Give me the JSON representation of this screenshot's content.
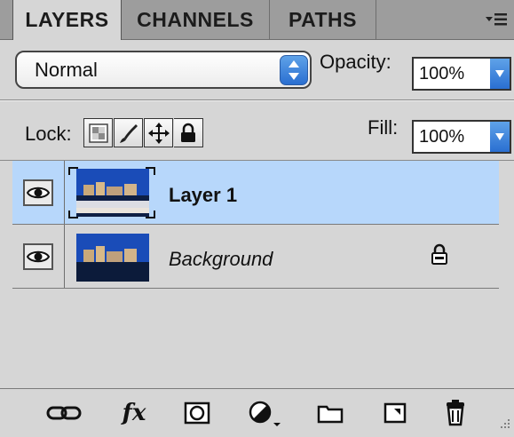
{
  "tabs": [
    {
      "label": "LAYERS",
      "active": true
    },
    {
      "label": "CHANNELS",
      "active": false
    },
    {
      "label": "PATHS",
      "active": false
    }
  ],
  "panel_menu_icon": "panel-menu-icon",
  "blend_mode": {
    "value": "Normal"
  },
  "opacity": {
    "label": "Opacity:",
    "value": "100%"
  },
  "lock": {
    "label": "Lock:",
    "icons": [
      "lock-transparent-pixels-icon",
      "lock-image-pixels-icon",
      "lock-position-icon",
      "lock-all-icon"
    ]
  },
  "fill": {
    "label": "Fill:",
    "value": "100%"
  },
  "layers": [
    {
      "name": "Layer 1",
      "visible": true,
      "selected": true,
      "locked": false
    },
    {
      "name": "Background",
      "visible": true,
      "selected": false,
      "locked": true
    }
  ],
  "toolbar": [
    "link-layers-icon",
    "fx",
    "add-mask-icon",
    "adjustment-layer-icon",
    "new-group-icon",
    "new-layer-icon",
    "trash-icon"
  ],
  "colors": {
    "selection": "#b7d7fb",
    "panel": "#d6d6d6",
    "tab_inactive": "#9d9d9d",
    "accent": "#2a6fd1"
  }
}
